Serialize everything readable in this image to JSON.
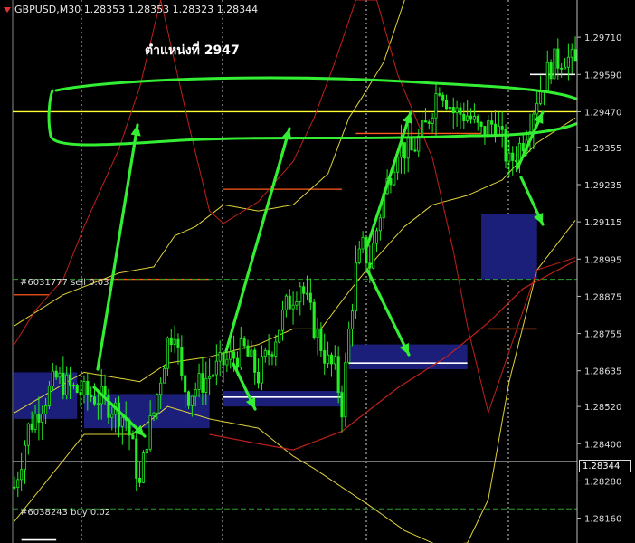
{
  "header": {
    "symbol_line": "GBPUSD,M30  1.28353 1.28353 1.28323 1.28344"
  },
  "annotation_text": "ตำแหน่งที่ 2947",
  "orders": [
    {
      "label": "#6031777 sell 0.03",
      "price": 1.2893
    },
    {
      "label": "#6038243 buy 0.02",
      "price": 1.2819
    }
  ],
  "current_price_label": "1.28344",
  "colors": {
    "background": "#000000",
    "bull": "#22ee22",
    "bear": "#22ee22",
    "band": "#e0d23a",
    "ma_red": "#c0201c",
    "yellow_level": "#ffff33",
    "orange_level": "#ff5a1a",
    "zone": "#1c1f7a",
    "annotation": "#33ee33"
  },
  "chart_data": {
    "type": "candlestick",
    "symbol": "GBPUSD",
    "timeframe": "M30",
    "ylim": [
      1.2808,
      1.2983
    ],
    "yticks": [
      "1.29710",
      "1.29590",
      "1.29470",
      "1.29355",
      "1.29235",
      "1.29115",
      "1.28995",
      "1.28875",
      "1.28755",
      "1.28635",
      "1.28520",
      "1.28400",
      "1.28280",
      "1.28160"
    ],
    "ohlc_anchors": [
      [
        0,
        1.2826
      ],
      [
        4,
        1.2845
      ],
      [
        8,
        1.2853
      ],
      [
        12,
        1.2861
      ],
      [
        16,
        1.2858
      ],
      [
        20,
        1.2856
      ],
      [
        24,
        1.2855
      ],
      [
        28,
        1.2852
      ],
      [
        32,
        1.2848
      ],
      [
        34,
        1.2838
      ],
      [
        36,
        1.2826
      ],
      [
        38,
        1.2842
      ],
      [
        40,
        1.285
      ],
      [
        42,
        1.2862
      ],
      [
        44,
        1.2873
      ],
      [
        46,
        1.2878
      ],
      [
        48,
        1.286
      ],
      [
        50,
        1.2856
      ],
      [
        52,
        1.2858
      ],
      [
        56,
        1.2862
      ],
      [
        60,
        1.2866
      ],
      [
        63,
        1.2868
      ],
      [
        66,
        1.287
      ],
      [
        70,
        1.2862
      ],
      [
        74,
        1.2872
      ],
      [
        78,
        1.2884
      ],
      [
        82,
        1.2892
      ],
      [
        86,
        1.2878
      ],
      [
        88,
        1.2872
      ],
      [
        90,
        1.2866
      ],
      [
        92,
        1.2864
      ],
      [
        94,
        1.2852
      ],
      [
        96,
        1.2876
      ],
      [
        98,
        1.2896
      ],
      [
        100,
        1.2903
      ],
      [
        102,
        1.2898
      ],
      [
        106,
        1.292
      ],
      [
        110,
        1.2936
      ],
      [
        114,
        1.2934
      ],
      [
        118,
        1.2942
      ],
      [
        122,
        1.2956
      ],
      [
        126,
        1.2947
      ],
      [
        130,
        1.2946
      ],
      [
        134,
        1.294
      ],
      [
        138,
        1.2944
      ],
      [
        142,
        1.293
      ],
      [
        146,
        1.2938
      ],
      [
        150,
        1.2952
      ],
      [
        154,
        1.2962
      ],
      [
        158,
        1.2965
      ],
      [
        161,
        1.2962
      ]
    ],
    "bollinger_upper": [
      [
        0,
        1.2878
      ],
      [
        14,
        1.2888
      ],
      [
        30,
        1.2895
      ],
      [
        40,
        1.2897
      ],
      [
        46,
        1.2907
      ],
      [
        52,
        1.291
      ],
      [
        60,
        1.2917
      ],
      [
        70,
        1.2915
      ],
      [
        80,
        1.2917
      ],
      [
        90,
        1.2927
      ],
      [
        96,
        1.2945
      ],
      [
        100,
        1.2952
      ],
      [
        106,
        1.2963
      ],
      [
        112,
        1.2983
      ]
    ],
    "bollinger_lower": [
      [
        0,
        1.2815
      ],
      [
        20,
        1.2843
      ],
      [
        34,
        1.2843
      ],
      [
        44,
        1.2852
      ],
      [
        56,
        1.2848
      ],
      [
        70,
        1.2845
      ],
      [
        80,
        1.2836
      ],
      [
        86,
        1.2832
      ],
      [
        94,
        1.2826
      ],
      [
        102,
        1.282
      ],
      [
        112,
        1.2812
      ],
      [
        122,
        1.2807
      ],
      [
        130,
        1.2808
      ],
      [
        136,
        1.2822
      ],
      [
        142,
        1.286
      ],
      [
        150,
        1.2896
      ],
      [
        161,
        1.2912
      ]
    ],
    "bollinger_mid": [
      [
        0,
        1.285
      ],
      [
        20,
        1.2863
      ],
      [
        36,
        1.286
      ],
      [
        44,
        1.2866
      ],
      [
        56,
        1.2868
      ],
      [
        70,
        1.2872
      ],
      [
        80,
        1.2877
      ],
      [
        88,
        1.2877
      ],
      [
        96,
        1.2889
      ],
      [
        104,
        1.29
      ],
      [
        112,
        1.291
      ],
      [
        120,
        1.2917
      ],
      [
        130,
        1.292
      ],
      [
        140,
        1.2925
      ],
      [
        150,
        1.2937
      ],
      [
        161,
        1.2945
      ]
    ],
    "moving_average_red": [
      [
        0,
        1.2872
      ],
      [
        6,
        1.2883
      ],
      [
        14,
        1.2893
      ],
      [
        20,
        1.291
      ],
      [
        30,
        1.2935
      ],
      [
        36,
        1.2955
      ],
      [
        42,
        1.2983
      ],
      [
        50,
        1.2943
      ],
      [
        56,
        1.2915
      ],
      [
        60,
        1.2911
      ],
      [
        70,
        1.2918
      ],
      [
        80,
        1.2931
      ],
      [
        86,
        1.2945
      ],
      [
        92,
        1.2963
      ],
      [
        98,
        1.2983
      ],
      [
        104,
        1.2983
      ],
      [
        110,
        1.2959
      ],
      [
        120,
        1.2932
      ],
      [
        126,
        1.2902
      ],
      [
        130,
        1.2878
      ],
      [
        136,
        1.285
      ],
      [
        150,
        1.2896
      ],
      [
        161,
        1.29
      ]
    ],
    "ma_red_lower": [
      [
        56,
        1.2843
      ],
      [
        70,
        1.284
      ],
      [
        80,
        1.2838
      ],
      [
        94,
        1.2844
      ],
      [
        110,
        1.2858
      ],
      [
        124,
        1.2868
      ],
      [
        136,
        1.2879
      ],
      [
        146,
        1.289
      ],
      [
        161,
        1.2899
      ]
    ],
    "yellow_level": 1.2947,
    "horizontal_levels": [
      {
        "price": 1.2922,
        "x_from": 60,
        "x_to": 94
      },
      {
        "price": 1.294,
        "x_from": 98,
        "x_to": 134
      },
      {
        "price": 1.2888,
        "x_from": 0,
        "x_to": 10
      },
      {
        "price": 1.2893,
        "x_from": 22,
        "x_to": 56
      },
      {
        "price": 1.2877,
        "x_from": 136,
        "x_to": 150
      }
    ],
    "zones": [
      {
        "x_from": 0,
        "x_to": 18,
        "top": 1.2863,
        "bottom": 1.2848
      },
      {
        "x_from": 20,
        "x_to": 56,
        "top": 1.2856,
        "bottom": 1.2845
      },
      {
        "x_from": 60,
        "x_to": 94,
        "top": 1.2857,
        "bottom": 1.2852
      },
      {
        "x_from": 96,
        "x_to": 130,
        "top": 1.2872,
        "bottom": 1.2864
      },
      {
        "x_from": 134,
        "x_to": 150,
        "top": 1.2914,
        "bottom": 1.2893
      }
    ]
  }
}
